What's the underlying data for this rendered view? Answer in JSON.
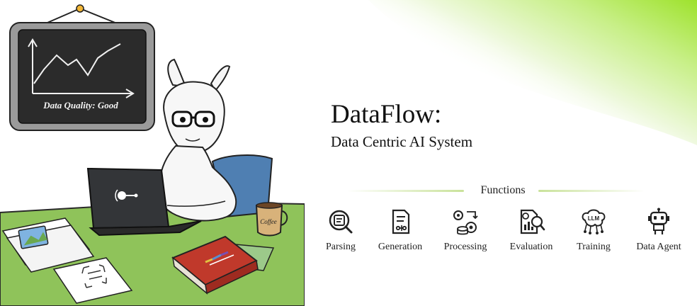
{
  "app": {
    "title": "DataFlow",
    "title_suffix": ":",
    "subtitle": "Data Centric AI System"
  },
  "illustration": {
    "board_caption": "Data Quality: Good",
    "mug_label": "Coffee"
  },
  "functions": {
    "header": "Functions",
    "items": [
      {
        "label": "Parsing",
        "icon": "parsing-icon"
      },
      {
        "label": "Generation",
        "icon": "generation-icon"
      },
      {
        "label": "Processing",
        "icon": "processing-icon"
      },
      {
        "label": "Evaluation",
        "icon": "evaluation-icon"
      },
      {
        "label": "Training",
        "icon": "training-icon",
        "badge": "LLM"
      },
      {
        "label": "Data Agent",
        "icon": "data-agent-icon"
      }
    ]
  },
  "colors": {
    "accent_green": "#9ee22c",
    "table_green": "#8fc35a",
    "chair_blue": "#4f7fb2",
    "book_red": "#c0392b"
  }
}
